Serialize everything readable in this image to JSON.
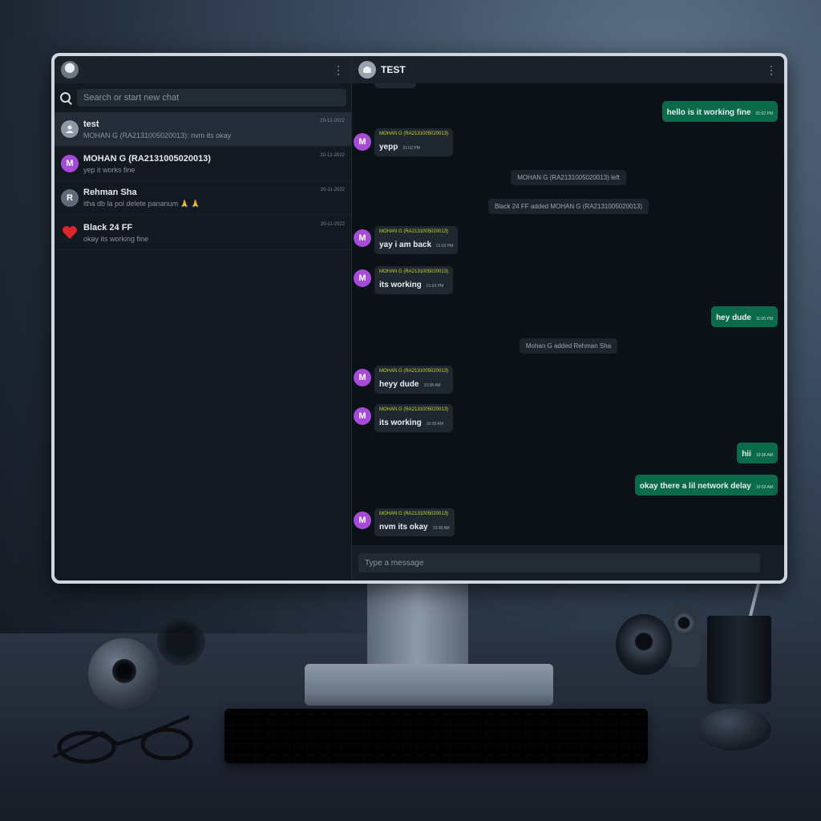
{
  "sidebar": {
    "search_placeholder": "Search or start new chat",
    "chats": [
      {
        "name": "test",
        "preview": "MOHAN G (RA2131005020013): nvm its okay",
        "date": "20-12-2022",
        "avatar": "group-icon"
      },
      {
        "name": "MOHAN G (RA2131005020013)",
        "preview": "yep it works fine",
        "date": "20-12-2022",
        "avatar_letter": "M"
      },
      {
        "name": "Rehman Sha",
        "preview": "itha db la poi delete pananum 🙏 🙏",
        "date": "20-11-2022",
        "avatar_letter": "R"
      },
      {
        "name": "Black 24 FF",
        "preview": "okay its working fine",
        "date": "20-11-2022",
        "avatar": "heart-icon"
      }
    ]
  },
  "main": {
    "title": "TEST",
    "messages": [
      {
        "dir": "out",
        "text": "hello is it working fine",
        "time": "01:02 PM"
      },
      {
        "dir": "in",
        "author": "MOHAN G (RA2131005020013)",
        "text": "yepp",
        "time": "01:02 PM",
        "avatar_letter": "M"
      },
      {
        "dir": "sys",
        "text": "MOHAN G (RA2131005020013) left"
      },
      {
        "dir": "sys",
        "text": "Black 24 FF added MOHAN G (RA2131005020013)"
      },
      {
        "dir": "in",
        "author": "MOHAN G (RA2131005020013)",
        "text": "yay i am back",
        "time": "01:03 PM",
        "avatar_letter": "M"
      },
      {
        "dir": "in",
        "author": "MOHAN G (RA2131005020013)",
        "text": "its working",
        "time": "01:03 PM",
        "avatar_letter": "M"
      },
      {
        "dir": "out",
        "text": "hey dude",
        "time": "11:00 PM"
      },
      {
        "dir": "sys",
        "text": "Mohan G added Rehman Sha"
      },
      {
        "dir": "in",
        "author": "MOHAN G (RA2131005020013)",
        "text": "heyy dude",
        "time": "10:38 AM",
        "avatar_letter": "M"
      },
      {
        "dir": "in",
        "author": "MOHAN G (RA2131005020013)",
        "text": "its working",
        "time": "10:35 AM",
        "avatar_letter": "M"
      },
      {
        "dir": "out",
        "text": "hii",
        "time": "10:38 AM"
      },
      {
        "dir": "out",
        "text": "okay there a lil network delay",
        "time": "10:33 AM"
      },
      {
        "dir": "in",
        "author": "MOHAN G (RA2131005020013)",
        "text": "nvm its okay",
        "time": "10:38 AM",
        "avatar_letter": "M"
      }
    ],
    "composer_placeholder": "Type a message"
  },
  "colors": {
    "outgoing_bubble": "#0b6a4a",
    "incoming_bubble": "#1f2730",
    "author_name": "#c7d62a",
    "avatar_purple": "#a54bd8"
  }
}
